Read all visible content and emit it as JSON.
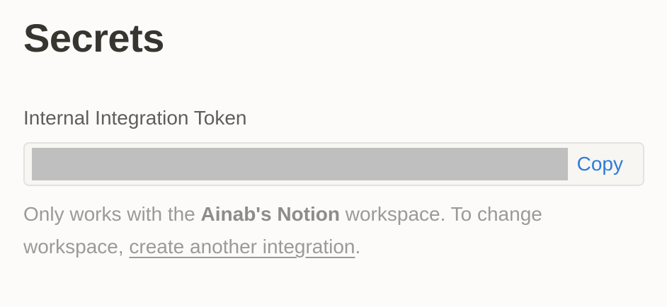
{
  "page": {
    "title": "Secrets"
  },
  "token": {
    "label": "Internal Integration Token",
    "copy_label": "Copy"
  },
  "help": {
    "prefix": "Only works with the ",
    "workspace_name": "Ainab's Notion",
    "middle": " workspace. To change workspace, ",
    "link_text": "create another integration",
    "suffix": "."
  },
  "colors": {
    "title": "#37352f",
    "label": "#5f5e5b",
    "link_blue": "#2f7bd8",
    "muted_text": "#9b9a97",
    "input_border": "#e3e2e0",
    "masked_token": "#bfbfbf"
  }
}
